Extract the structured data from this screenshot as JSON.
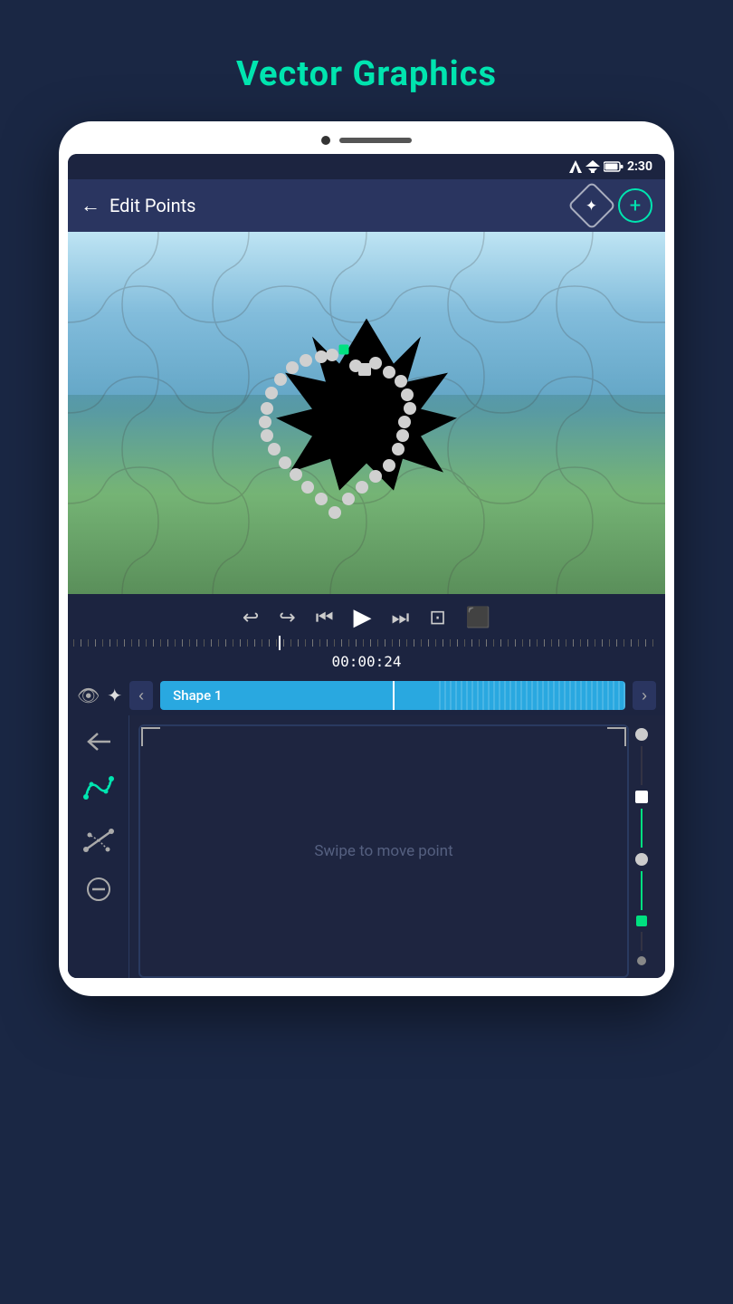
{
  "page": {
    "title": "Vector Graphics",
    "title_color": "#00e5b0"
  },
  "status_bar": {
    "time": "2:30",
    "signal": "▲",
    "wifi": "▼",
    "battery": "🔋"
  },
  "header": {
    "back_label": "←",
    "title": "Edit Points",
    "btn_diamond_label": "◇",
    "btn_plus_label": "+"
  },
  "playback": {
    "undo_label": "↩",
    "redo_label": "↪",
    "skip_start_label": "|◀",
    "play_label": "▶",
    "skip_end_label": "▶|",
    "loop_label": "⊡",
    "bookmark_label": "🔖",
    "timecode": "00:00:24"
  },
  "track": {
    "eye_label": "👁",
    "puzzle_label": "⬡",
    "prev_label": "‹",
    "next_label": "›",
    "block_label": "Shape 1"
  },
  "tools": {
    "back_label": "←",
    "curve_smooth_label": "~",
    "curve_corner_label": "⌐",
    "minus_label": "−"
  },
  "swipe_hint": "Swipe to move point"
}
